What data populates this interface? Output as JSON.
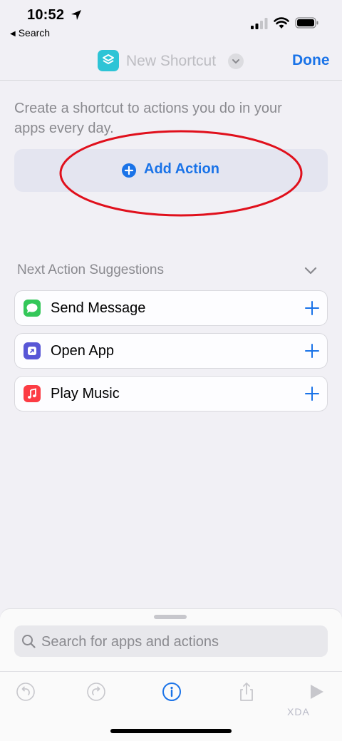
{
  "status_bar": {
    "time": "10:52",
    "back_app": "Search"
  },
  "nav": {
    "title": "New Shortcut",
    "done_label": "Done",
    "app_icon_color": "#2ec4d6"
  },
  "content": {
    "intro_text": "Create a shortcut to actions you do in your apps every day.",
    "add_action_label": "Add Action",
    "suggestions_header": "Next Action Suggestions",
    "suggestions": [
      {
        "label": "Send Message",
        "icon": "messages-icon",
        "color": "#34c759"
      },
      {
        "label": "Open App",
        "icon": "open-app-icon",
        "color": "#5856d6"
      },
      {
        "label": "Play Music",
        "icon": "music-icon",
        "color": "#fc3c44"
      }
    ]
  },
  "sheet": {
    "search_placeholder": "Search for apps and actions"
  },
  "watermark": "XDA",
  "colors": {
    "accent": "#1a73e8",
    "highlight_ring": "#e0101c"
  }
}
